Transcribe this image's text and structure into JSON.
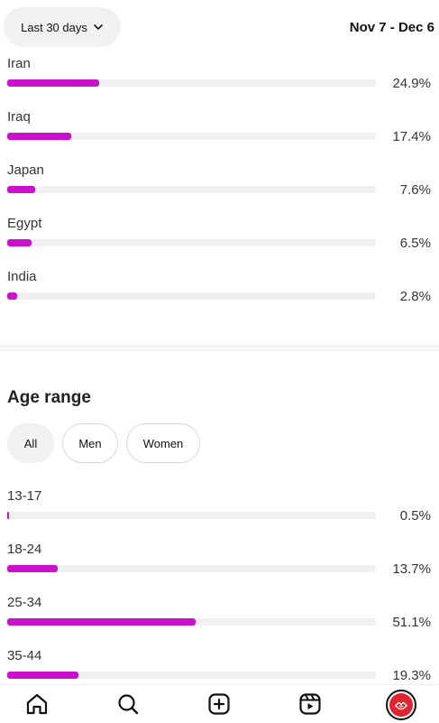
{
  "header": {
    "range_label": "Last 30 days",
    "date_range": "Nov 7 - Dec 6"
  },
  "countries": [
    {
      "name": "Iran",
      "percent_label": "24.9%",
      "value": 24.9
    },
    {
      "name": "Iraq",
      "percent_label": "17.4%",
      "value": 17.4
    },
    {
      "name": "Japan",
      "percent_label": "7.6%",
      "value": 7.6
    },
    {
      "name": "Egypt",
      "percent_label": "6.5%",
      "value": 6.5
    },
    {
      "name": "India",
      "percent_label": "2.8%",
      "value": 2.8
    }
  ],
  "age_section": {
    "title": "Age range",
    "filters": [
      "All",
      "Men",
      "Women"
    ],
    "active_filter": "All",
    "ranges": [
      {
        "name": "13-17",
        "percent_label": "0.5%",
        "value": 0.5
      },
      {
        "name": "18-24",
        "percent_label": "13.7%",
        "value": 13.7
      },
      {
        "name": "25-34",
        "percent_label": "51.1%",
        "value": 51.1
      },
      {
        "name": "35-44",
        "percent_label": "19.3%",
        "value": 19.3
      }
    ]
  },
  "bar_scale_max_percent": 100,
  "colors": {
    "bar_fill": "#cc0fcc",
    "bar_track": "#f0f0f2",
    "avatar": "#e0242f"
  },
  "nav": [
    "home-icon",
    "search-icon",
    "create-icon",
    "reels-icon",
    "profile-avatar"
  ]
}
